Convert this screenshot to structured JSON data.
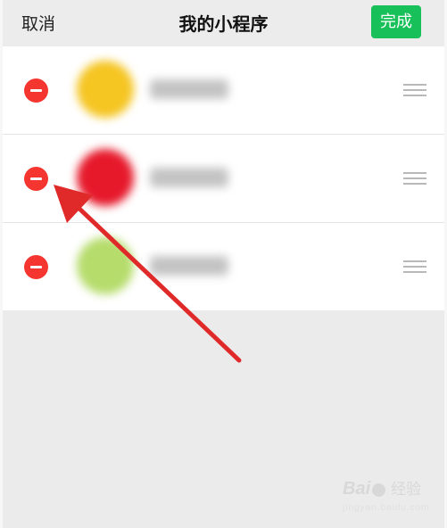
{
  "header": {
    "cancel_label": "取消",
    "title": "我的小程序",
    "done_label": "完成"
  },
  "apps": [
    {
      "icon_color": "#f5c522",
      "icon_name": "app-icon-yellow"
    },
    {
      "icon_color": "#e6192b",
      "icon_name": "app-icon-red"
    },
    {
      "icon_color": "#b6dc6c",
      "icon_name": "app-icon-green"
    }
  ],
  "colors": {
    "accent_green": "#17c058",
    "remove_red": "#f5352f",
    "arrow_red": "#e02a2a",
    "background": "#ebebeb"
  },
  "watermark": {
    "logo": "Bai",
    "product": "经验",
    "url": "jingyan.baidu.com"
  }
}
